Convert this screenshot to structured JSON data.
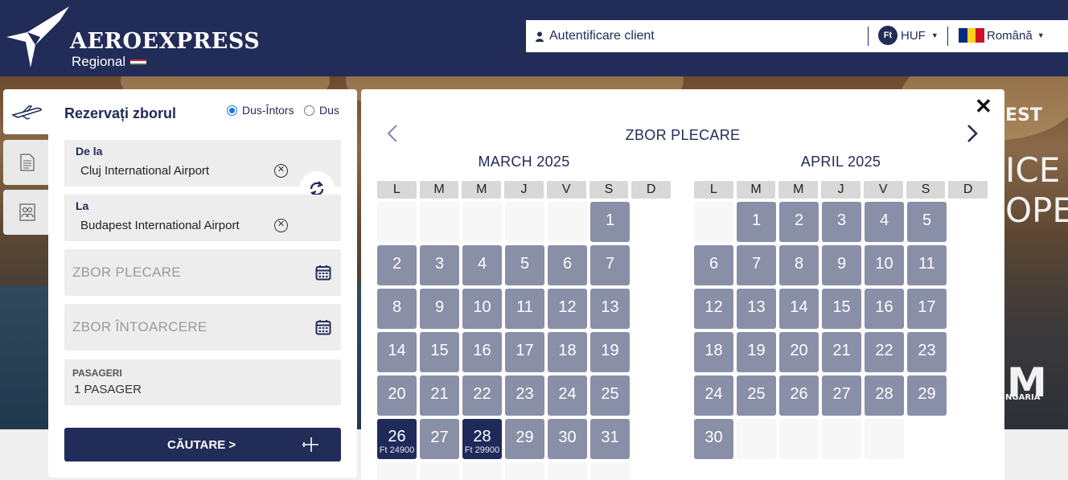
{
  "header": {
    "brand": "AEROEXPRESS",
    "brand_sub": "Regional",
    "login_label": "Autentificare client",
    "currency_symbol": "Ft",
    "currency": "HUF",
    "language": "Română"
  },
  "promo": {
    "line1": "EST",
    "line2": "ICE",
    "line3": "OPE",
    "line4": "M",
    "line5": "NGARIA"
  },
  "booking": {
    "title": "Rezervați zborul",
    "trip_types": [
      {
        "label": "Dus-Întors",
        "checked": true
      },
      {
        "label": "Dus",
        "checked": false
      }
    ],
    "from_label": "De la",
    "from_value": "Cluj International Airport",
    "to_label": "La",
    "to_value": "Budapest International Airport",
    "departure_placeholder": "ZBOR PLECARE",
    "return_placeholder": "ZBOR ÎNTOARCERE",
    "passengers_label": "PASAGERI",
    "passengers_value": "1 PASAGER",
    "search_label": "CĂUTARE >"
  },
  "calendar": {
    "title": "ZBOR PLECARE",
    "weekdays": [
      "L",
      "M",
      "M",
      "J",
      "V",
      "S",
      "D"
    ],
    "months": [
      {
        "name": "MARCH 2025",
        "leading_empty": 5,
        "days": 31,
        "trailing_empty": 6,
        "available": {
          "26": "Ft 24900",
          "28": "Ft 29900"
        }
      },
      {
        "name": "APRIL 2025",
        "leading_empty": 1,
        "days": 30,
        "trailing_empty": 4,
        "available": {}
      }
    ]
  },
  "colors": {
    "navy": "#222c58",
    "day_disabled": "#8a8fa8",
    "day_available": "#1f2a5b"
  }
}
